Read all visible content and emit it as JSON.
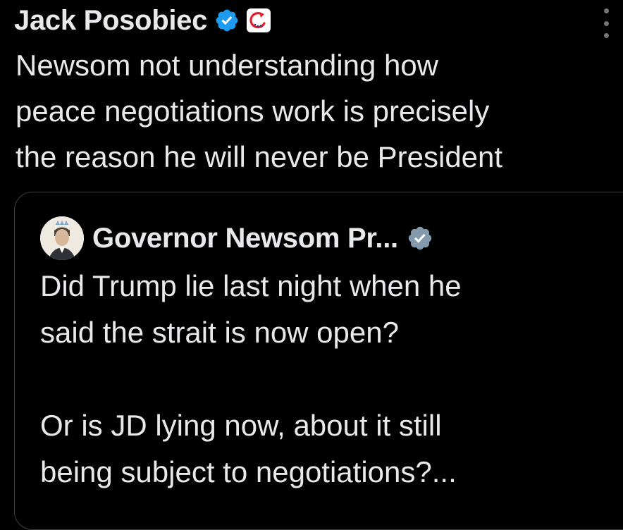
{
  "tweet": {
    "author_name": "Jack Posobiec",
    "verified_icon": "verified-badge-icon",
    "affiliation_icon": "affiliation-badge-icon",
    "more_icon": "more-vertical-icon",
    "text": "Newsom not understanding how\npeace negotiations work is precisely\nthe reason he will never be President"
  },
  "quoted_tweet": {
    "author_name": "Governor Newsom Pr...",
    "avatar_icon": "avatar",
    "verified_icon": "gray-verified-badge-icon",
    "text": "Did Trump lie last night when he\nsaid the strait is now open?\n\nOr is JD lying now, about it still\nbeing subject to negotiations?..."
  },
  "colors": {
    "background": "#000000",
    "text": "#e7e9ea",
    "blue_verified": "#1d9bf0",
    "gray_verified": "#829aab",
    "border": "#3a3e42",
    "muted": "#71767b"
  }
}
